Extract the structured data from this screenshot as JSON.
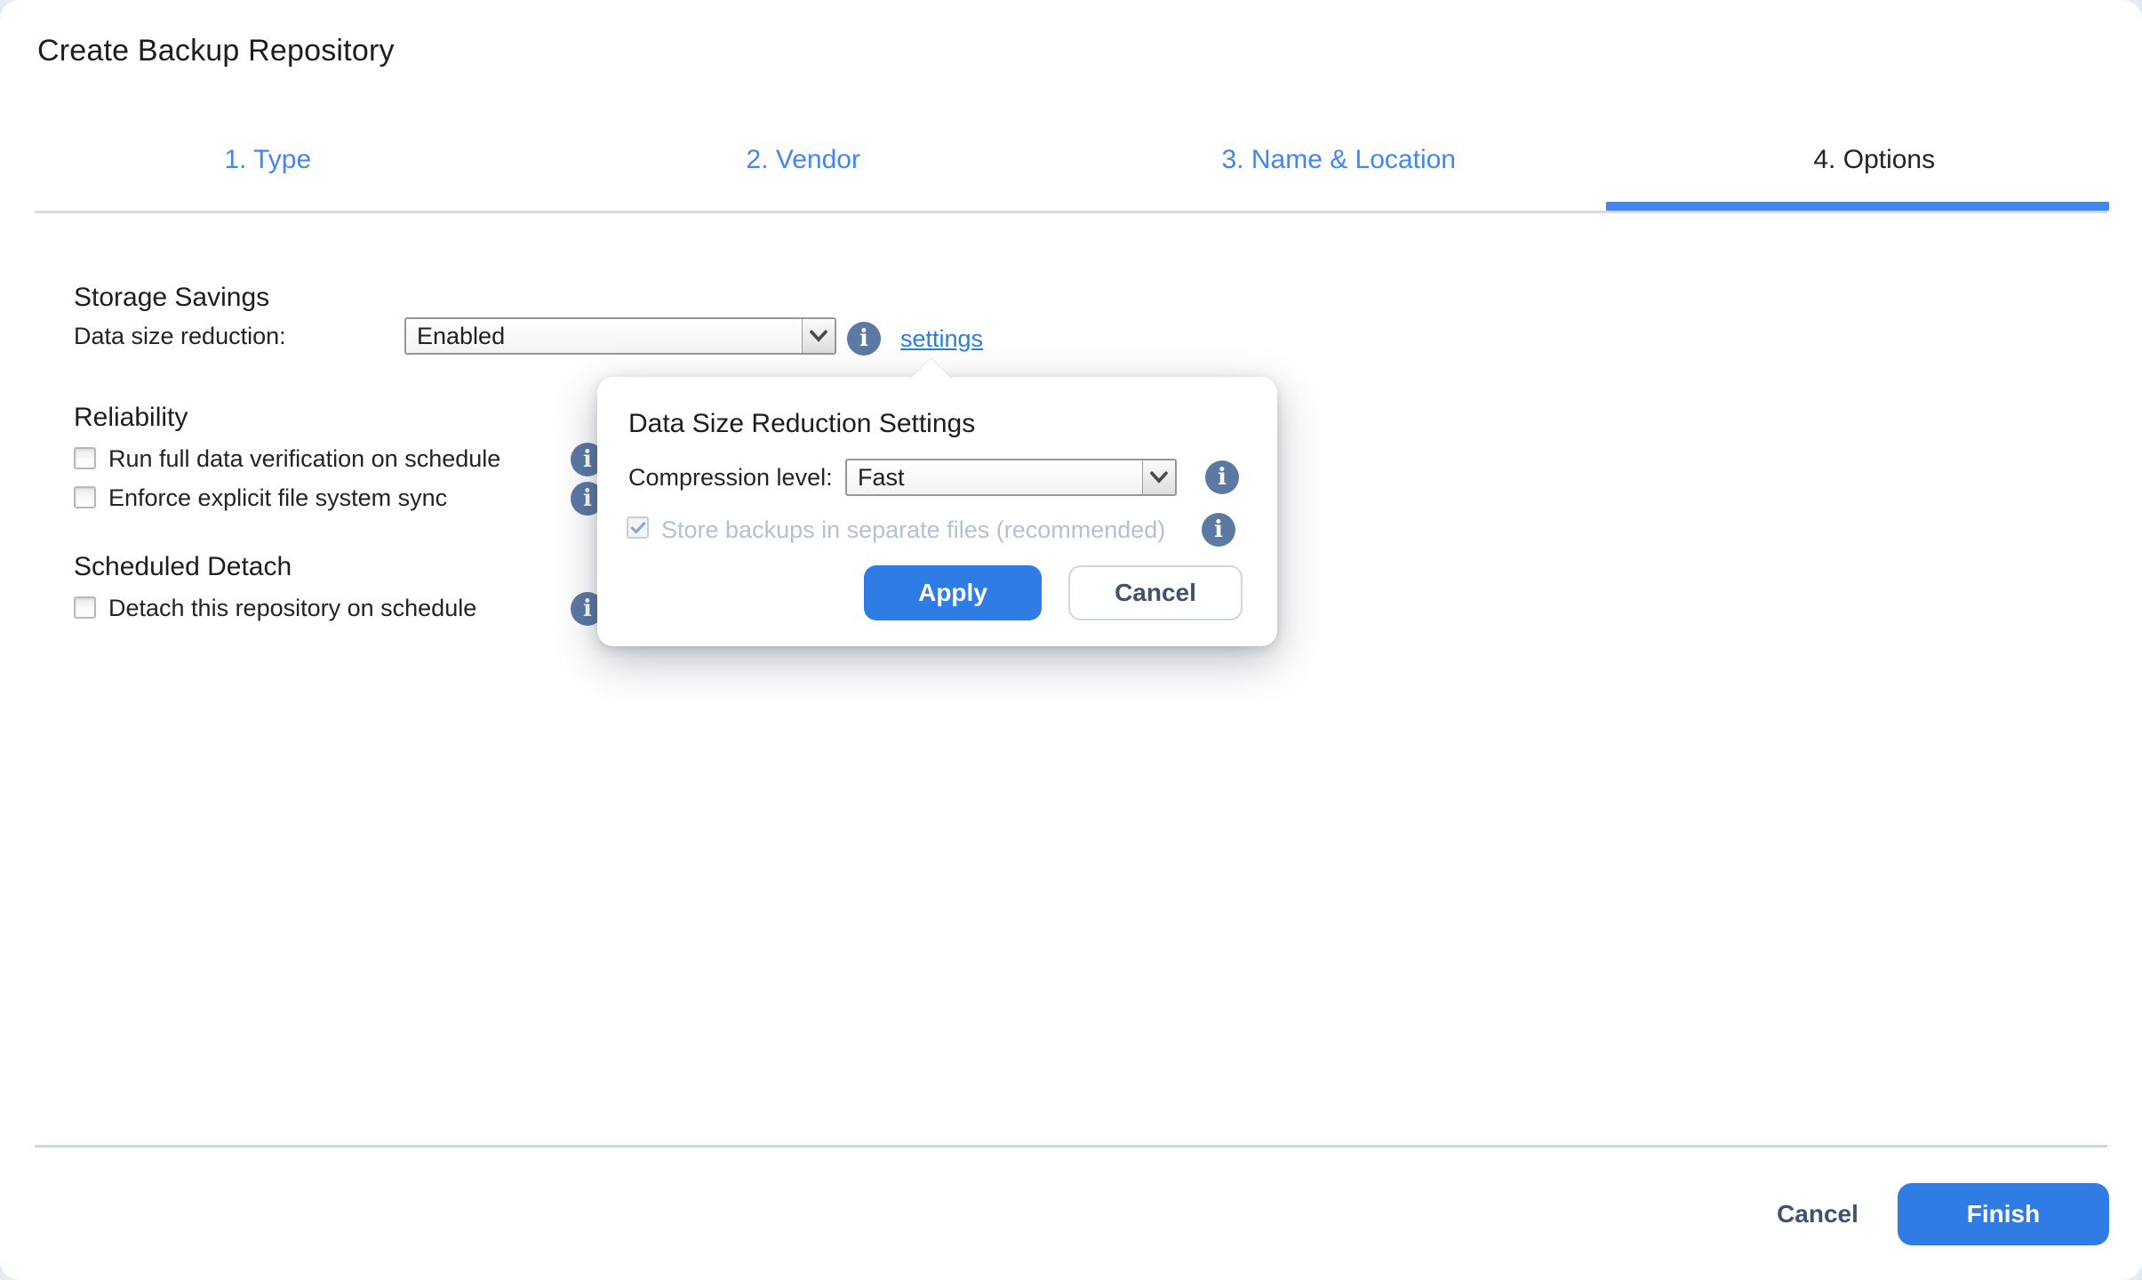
{
  "window": {
    "title": "Create Backup Repository"
  },
  "tabs": [
    {
      "label": "1. Type",
      "active": false
    },
    {
      "label": "2. Vendor",
      "active": false
    },
    {
      "label": "3. Name & Location",
      "active": false
    },
    {
      "label": "4. Options",
      "active": true
    }
  ],
  "sections": {
    "storage_savings": {
      "heading": "Storage Savings",
      "data_size_reduction": {
        "label": "Data size reduction:",
        "value": "Enabled",
        "settings_link": "settings"
      }
    },
    "reliability": {
      "heading": "Reliability",
      "checkboxes": [
        {
          "label": "Run full data verification on schedule",
          "checked": false
        },
        {
          "label": "Enforce explicit file system sync",
          "checked": false
        }
      ]
    },
    "scheduled_detach": {
      "heading": "Scheduled Detach",
      "checkboxes": [
        {
          "label": "Detach this repository on schedule",
          "checked": false
        }
      ]
    }
  },
  "popover": {
    "title": "Data Size Reduction Settings",
    "compression": {
      "label": "Compression level:",
      "value": "Fast"
    },
    "separate_files": {
      "label": "Store backups in separate files (recommended)",
      "checked": true,
      "disabled": true
    },
    "apply_label": "Apply",
    "cancel_label": "Cancel"
  },
  "footer": {
    "cancel_label": "Cancel",
    "finish_label": "Finish"
  },
  "colors": {
    "accent_blue": "#2e7ce4",
    "tab_blue": "#4285f4",
    "active_tab_bar": "#4486f2",
    "link_blue": "#2b7de2",
    "info_icon": "#5b79a3",
    "disabled_text": "#b3c0d6",
    "slate_text": "#42516e"
  }
}
